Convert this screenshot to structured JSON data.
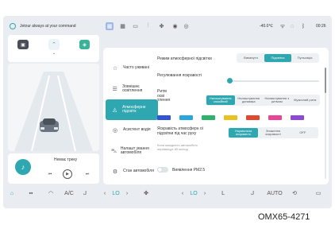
{
  "status": {
    "assistant_text": "Jetour always at your command",
    "temperature": "-40.0℃",
    "time": "00:26"
  },
  "media": {
    "track": "Немає треку"
  },
  "sidebar": {
    "items": [
      {
        "label": "Часто уживані",
        "icon": "star-icon",
        "active": false
      },
      {
        "label": "Зовнішнє освітлення",
        "icon": "headlight-icon",
        "active": false
      },
      {
        "label": "Атмосферне підсвітк",
        "icon": "ambient-light-icon",
        "active": true
      },
      {
        "label": "Асистент водія",
        "icon": "steering-icon",
        "active": false
      },
      {
        "label": "Налашт ування автомобіля",
        "icon": "car-icon",
        "active": false
      },
      {
        "label": "Стан автомобіля",
        "icon": "gear-icon",
        "active": false
      }
    ]
  },
  "settings": {
    "mode_label": "Режим атмосферної підсвітки",
    "mode_options": [
      "Вимкнути",
      "Підсвітка",
      "Пульсація"
    ],
    "mode_selected": "Підсвітка",
    "brightness_label": "Регулювання яскравості",
    "rhythm_label": "Ритм осві тлення",
    "rhythm_options": [
      "Налаштування спокійний",
      "Налаштування динаміка",
      "Налаштування з ритмом",
      "Музичний ритм"
    ],
    "rhythm_selected": "Налаштування спокійний",
    "swatch_colors": [
      "#2f55d4",
      "#2aa6df",
      "#2fb36b",
      "#e8c21f",
      "#e2472f",
      "#e84597",
      "#8b4ad8"
    ],
    "drive_brightness_label": "Яскравість атмосферн ої підсвітки під час руху",
    "drive_brightness_note": "Коли швидкість автомобіля перевищує 80 км/год",
    "drive_options": [
      "Нормальна яскравість",
      "Зниження яскравості",
      "OFF"
    ],
    "drive_selected": "Нормальна яскравість",
    "pm_label": "Виявлення PM2.5"
  },
  "dock": {
    "ac_label": "A/C",
    "lo_left": "LO",
    "lo_right": "LO",
    "auto_label": "AUTO"
  },
  "caption": "OMX65-4271"
}
